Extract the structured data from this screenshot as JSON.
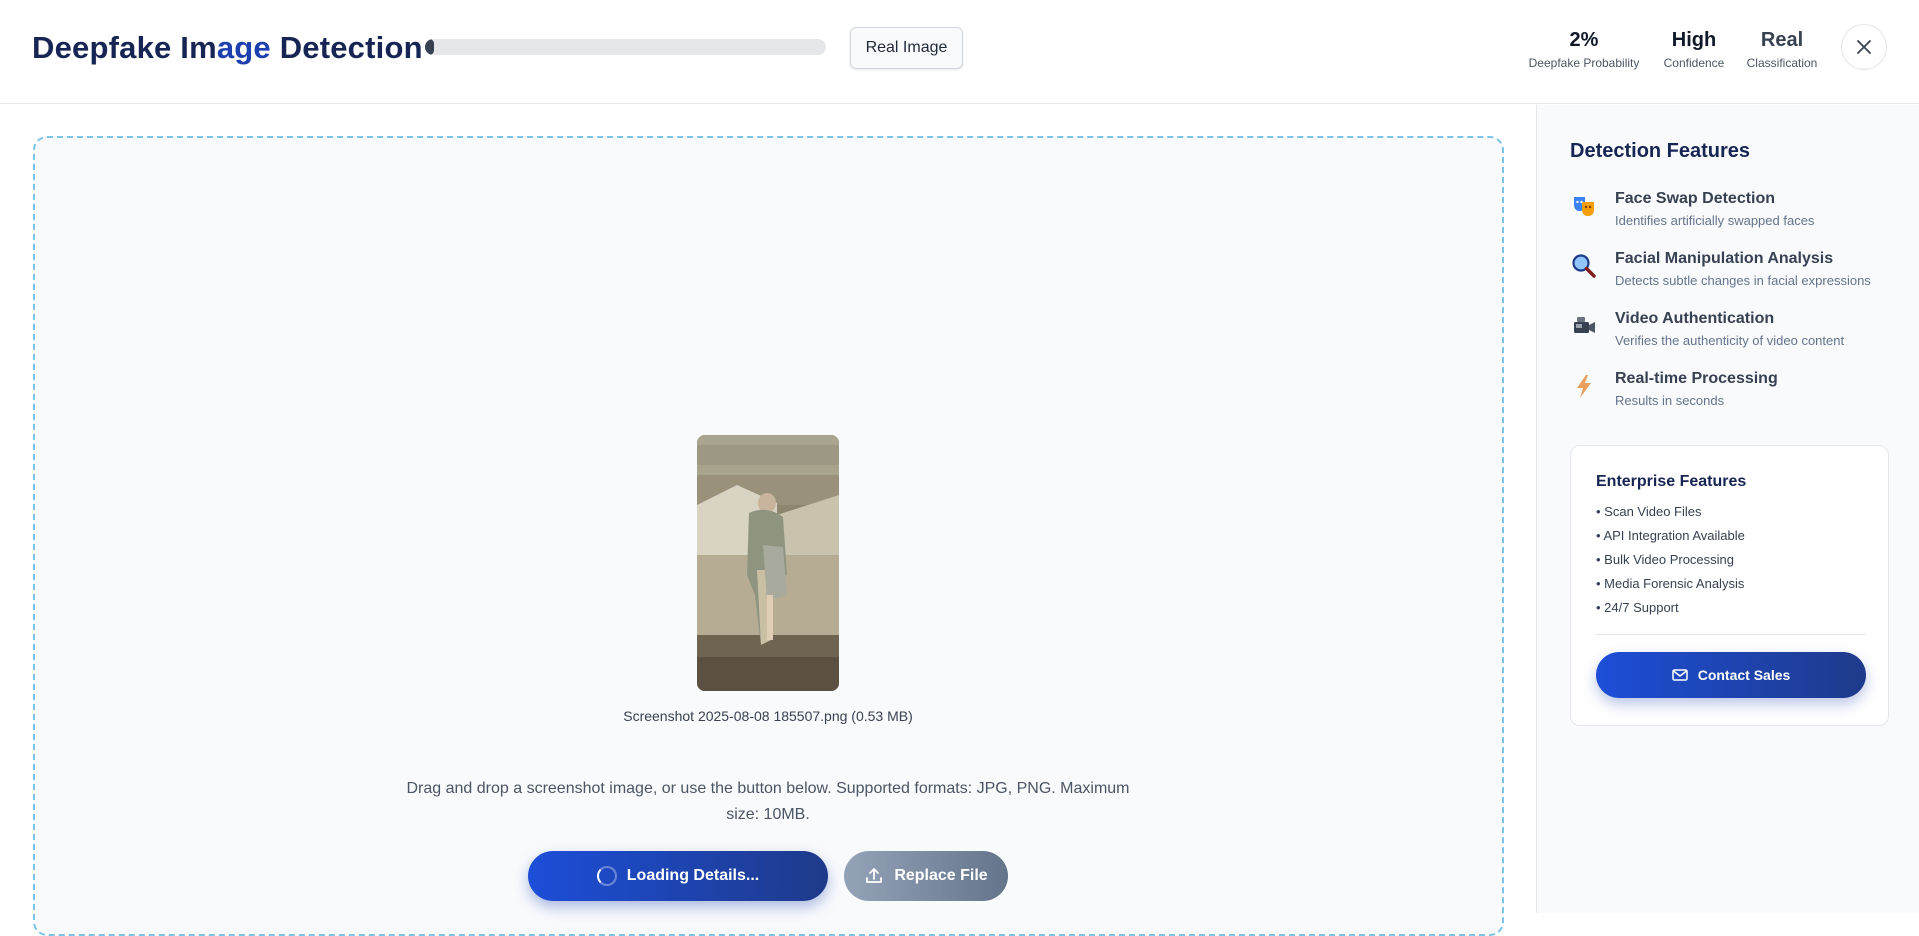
{
  "header": {
    "title_part1": "Deepfake Im",
    "title_part2": "age",
    "title_part3": " Detection",
    "progress_percent": 2,
    "result_button_label": "Real Image",
    "stats": [
      {
        "value": "2%",
        "label": "Deepfake Probability"
      },
      {
        "value": "High",
        "label": "Confidence"
      },
      {
        "value": "Real",
        "label": "Classification"
      }
    ],
    "close_icon": "close-icon"
  },
  "upload": {
    "file_name": "Screenshot 2025-08-08 185507.png (0.53 MB)",
    "help_text": "Drag and drop a screenshot image, or use the button below. Supported formats: JPG, PNG. Maximum size: 10MB.",
    "loading_label": "Loading Details...",
    "replace_label": "Replace File"
  },
  "sidebar": {
    "title": "Detection Features",
    "features": [
      {
        "name": "Face Swap Detection",
        "desc": "Identifies artificially swapped faces",
        "icon": "theater-masks-icon"
      },
      {
        "name": "Facial Manipulation Analysis",
        "desc": "Detects subtle changes in facial expressions",
        "icon": "magnifier-icon"
      },
      {
        "name": "Video Authentication",
        "desc": "Verifies the authenticity of video content",
        "icon": "video-camera-icon"
      },
      {
        "name": "Real-time Processing",
        "desc": "Results in seconds",
        "icon": "lightning-icon"
      }
    ],
    "enterprise": {
      "title": "Enterprise Features",
      "items": [
        "• Scan Video Files",
        "• API Integration Available",
        "• Bulk Video Processing",
        "• Media Forensic Analysis",
        "• 24/7 Support"
      ],
      "contact_label": "Contact Sales"
    }
  },
  "colors": {
    "brand_dark": "#172554",
    "brand_blue": "#1d4ed8",
    "dropzone_border": "#7dc3e8"
  }
}
